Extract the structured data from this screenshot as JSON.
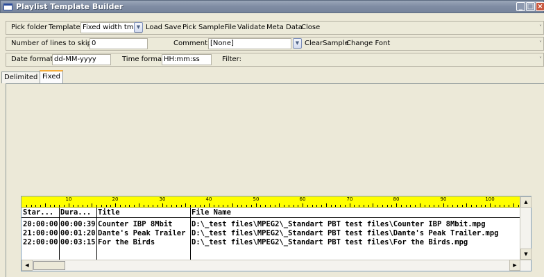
{
  "window": {
    "title": "Playlist Template Builder"
  },
  "toolbar1": {
    "pick_folder": "Pick folder",
    "template_label": "Template:",
    "template_value": "Fixed width tmpl",
    "load": "Load",
    "save": "Save",
    "pick": "Pick",
    "sample_file": "SampleFile",
    "validate": "Validate",
    "meta_data": "Meta Data",
    "close": "Close"
  },
  "toolbar2": {
    "skip_label": "Number of lines to skip:",
    "skip_value": "0",
    "comment_label": "Comment:",
    "comment_value": "[None]",
    "clear_sample": "ClearSample",
    "change_font": "Change Font"
  },
  "toolbar3": {
    "date_label": "Date format:",
    "date_value": "dd-MM-yyyy",
    "time_label": "Time format:",
    "time_value": "HH:mm:ss",
    "filter_label": "Filter:",
    "filter_value": ""
  },
  "tabs": [
    {
      "label": "Delimited"
    },
    {
      "label": "Fixed"
    }
  ],
  "active_tab": "Fixed",
  "ruler": {
    "marks": [
      "10",
      "20",
      "30",
      "40",
      "50",
      "60",
      "70",
      "80",
      "90",
      "100"
    ],
    "color": "#ffff00"
  },
  "grid": {
    "columns": [
      "Star...",
      "Dura...",
      "Title",
      "File Name"
    ],
    "rows": [
      [
        "20:00:00",
        "00:00:39",
        "Counter IBP 8Mbit",
        "D:\\_test files\\MPEG2\\_Standart PBT test files\\Counter IBP 8Mbit.mpg"
      ],
      [
        "21:00:00",
        "00:01:20",
        "Dante's Peak Trailer",
        "D:\\_test files\\MPEG2\\_Standart PBT test files\\Dante's Peak Trailer.mpg"
      ],
      [
        "22:00:00",
        "00:03:15",
        "For the Birds",
        "D:\\_test files\\MPEG2\\_Standart PBT test files\\For the Birds.mpg"
      ]
    ]
  },
  "icons": {
    "app": "window-icon",
    "minimize": "minimize-icon",
    "maximize": "maximize-icon",
    "close": "close-icon",
    "dropdown": "chevron-down-icon",
    "scroll_up": "arrow-up-icon",
    "scroll_down": "arrow-down-icon",
    "scroll_left": "arrow-left-icon",
    "scroll_right": "arrow-right-icon"
  }
}
